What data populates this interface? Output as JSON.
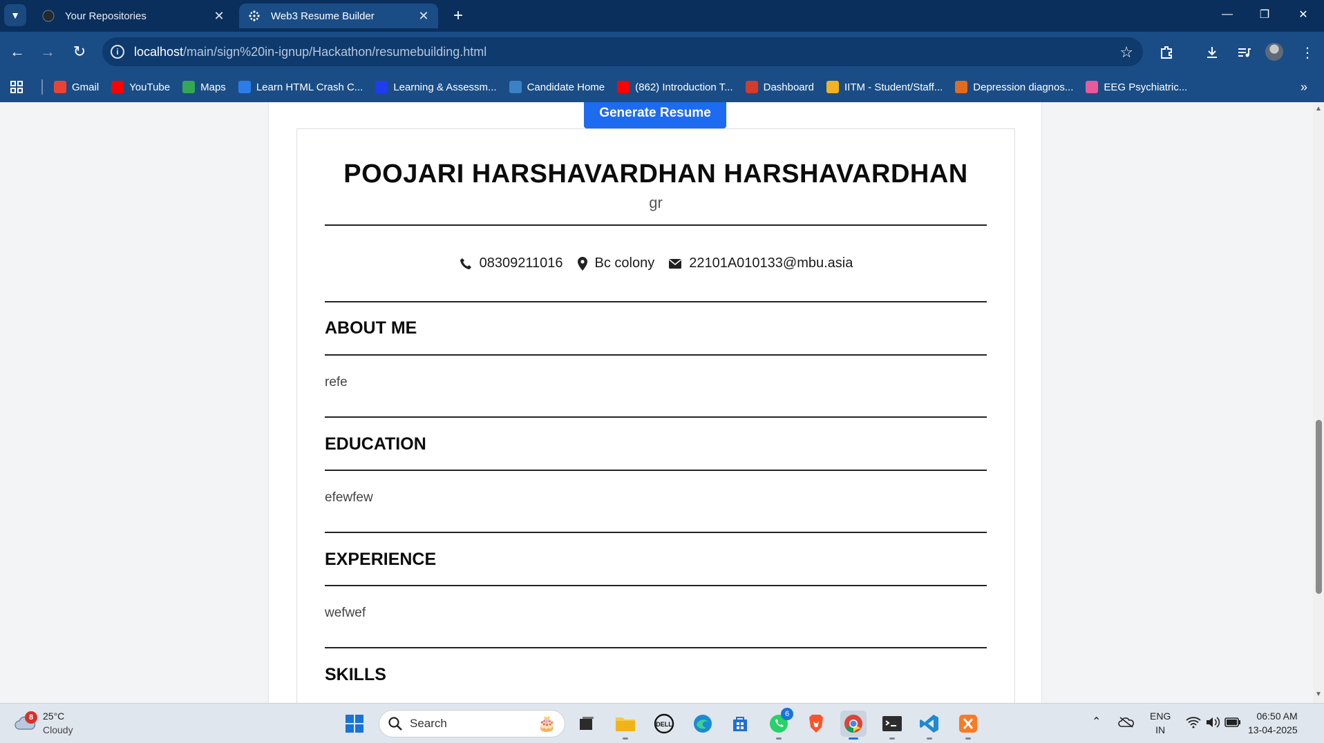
{
  "browser": {
    "tabs": [
      {
        "label": "Your Repositories",
        "icon": "github-icon"
      },
      {
        "label": "Web3 Resume Builder",
        "icon": "web3-icon"
      }
    ],
    "address": {
      "host": "localhost",
      "path": "/main/sign%20in-ignup/Hackathon/resumebuilding.html"
    },
    "bookmarks": [
      {
        "label": "Gmail",
        "icon": "gmail-icon",
        "color": "#ea4335"
      },
      {
        "label": "YouTube",
        "icon": "youtube-icon",
        "color": "#ff0000"
      },
      {
        "label": "Maps",
        "icon": "maps-icon",
        "color": "#34a853"
      },
      {
        "label": "Learn HTML Crash C...",
        "icon": "m-icon",
        "color": "#2b7de9"
      },
      {
        "label": "Learning & Assessm...",
        "icon": "learning-icon",
        "color": "#1f3cf0"
      },
      {
        "label": "Candidate Home",
        "icon": "candidate-icon",
        "color": "#3b82c4"
      },
      {
        "label": "(862) Introduction T...",
        "icon": "youtube-icon",
        "color": "#ff0000"
      },
      {
        "label": "Dashboard",
        "icon": "dashboard-icon",
        "color": "#d33b2c"
      },
      {
        "label": "IITM - Student/Staff...",
        "icon": "iitm-icon",
        "color": "#f2b321"
      },
      {
        "label": "Depression diagnos...",
        "icon": "e-icon",
        "color": "#e26b1e"
      },
      {
        "label": "EEG Psychiatric...",
        "icon": "brain-icon",
        "color": "#e95a9c"
      }
    ]
  },
  "page": {
    "generate_button": "Generate Resume",
    "resume": {
      "name": "POOJARI HARSHAVARDHAN HARSHAVARDHAN",
      "title": "gr",
      "phone": "08309211016",
      "location": "Bc colony",
      "email": "22101A010133@mbu.asia",
      "sections": [
        {
          "heading": "ABOUT ME",
          "text": "refe"
        },
        {
          "heading": "EDUCATION",
          "text": "efewfew"
        },
        {
          "heading": "EXPERIENCE",
          "text": "wefwef"
        },
        {
          "heading": "SKILLS",
          "text": ""
        }
      ]
    }
  },
  "taskbar": {
    "weather": {
      "temp": "25°C",
      "condition": "Cloudy",
      "badge": "8"
    },
    "search_placeholder": "Search",
    "whatsapp_badge": "6",
    "lang": {
      "line1": "ENG",
      "line2": "IN"
    },
    "time": "06:50 AM",
    "date": "13-04-2025"
  }
}
